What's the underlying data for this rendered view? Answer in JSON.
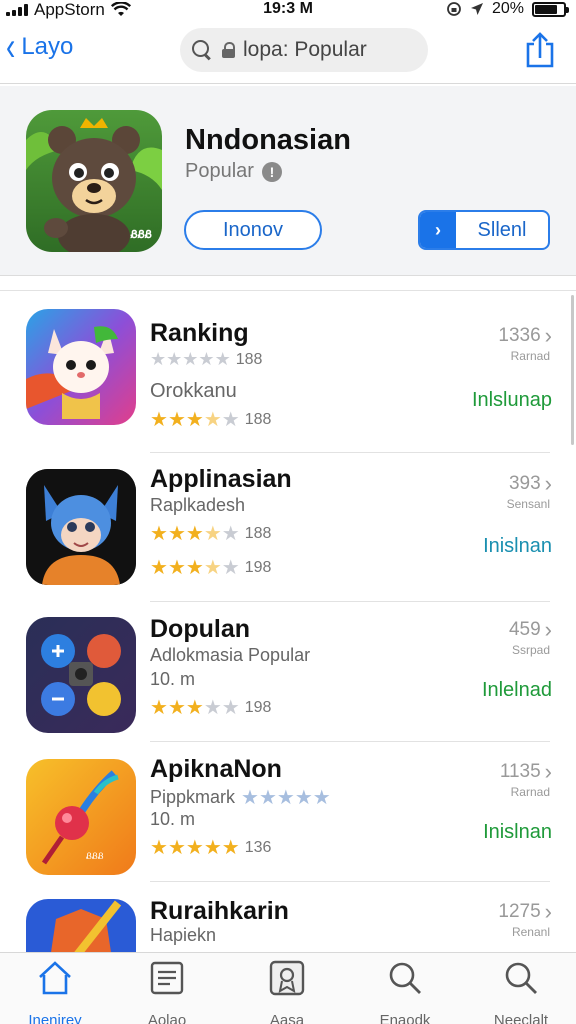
{
  "status_bar": {
    "carrier": "AppStorn",
    "time": "19:3 M",
    "battery_percent": "20%",
    "battery_level": 0.8
  },
  "nav": {
    "back_label": "Layo",
    "search_text": "lopa: Popular"
  },
  "featured": {
    "title": "Nndonasian",
    "subtitle": "Popular",
    "info_glyph": "!",
    "button_outline": "Inonov",
    "button_split": "Sllenl",
    "icon_badge": "ᏰᏰᏰ"
  },
  "apps": [
    {
      "name": "Ranking",
      "line1": {
        "text": "",
        "rating": 1,
        "rating_style": "gray",
        "count": "188"
      },
      "line2": {
        "text": "Orokkanu"
      },
      "line3": {
        "rating": 3.5,
        "count": "188"
      },
      "right_number": "1336",
      "right_sub": "Rarnad",
      "action": "Inlslunap",
      "action_color": "#1f9a3a"
    },
    {
      "name": "Applinasian",
      "line1": {
        "text": "Raplkadesh"
      },
      "line2": {
        "rating": 3.5,
        "count": "188"
      },
      "line3": {
        "rating": 3.5,
        "count": "198"
      },
      "right_number": "393",
      "right_sub": "Sensanl",
      "action": "Inislnan",
      "action_color": "#1a8fb0"
    },
    {
      "name": "Dopulan",
      "line1": {
        "text": "Adlokmasia Popular"
      },
      "line2": {
        "text": "10. m"
      },
      "line3": {
        "rating": 3,
        "count": "198"
      },
      "right_number": "459",
      "right_sub": "Ssrpad",
      "action": "Inlelnad",
      "action_color": "#1f9a3a"
    },
    {
      "name": "ApiknaNon",
      "line1": {
        "text": "Pippkmark",
        "rating": 0,
        "rating_style": "blue"
      },
      "line2": {
        "text": "10. m"
      },
      "line3": {
        "rating": 5,
        "count": "136"
      },
      "right_number": "1135",
      "right_sub": "Rarnad",
      "action": "Inislnan",
      "action_color": "#1f9a3a"
    },
    {
      "name": "Ruraihkarin",
      "line1": {
        "text": "Hapiekn"
      },
      "right_number": "1275",
      "right_sub": "Renanl"
    }
  ],
  "tabs": [
    {
      "label": "Inenirey",
      "icon": "home-icon",
      "active": true
    },
    {
      "label": "Aolao",
      "icon": "list-icon",
      "active": false
    },
    {
      "label": "Aasa",
      "icon": "badge-icon",
      "active": false
    },
    {
      "label": "Enaodk",
      "icon": "search-icon",
      "active": false
    },
    {
      "label": "Neeclalt",
      "icon": "search-icon",
      "active": false
    }
  ],
  "colors": {
    "accent": "#1a73e8",
    "star": "#f2b01e",
    "green_action": "#1f9a3a",
    "teal_action": "#1a8fb0"
  }
}
